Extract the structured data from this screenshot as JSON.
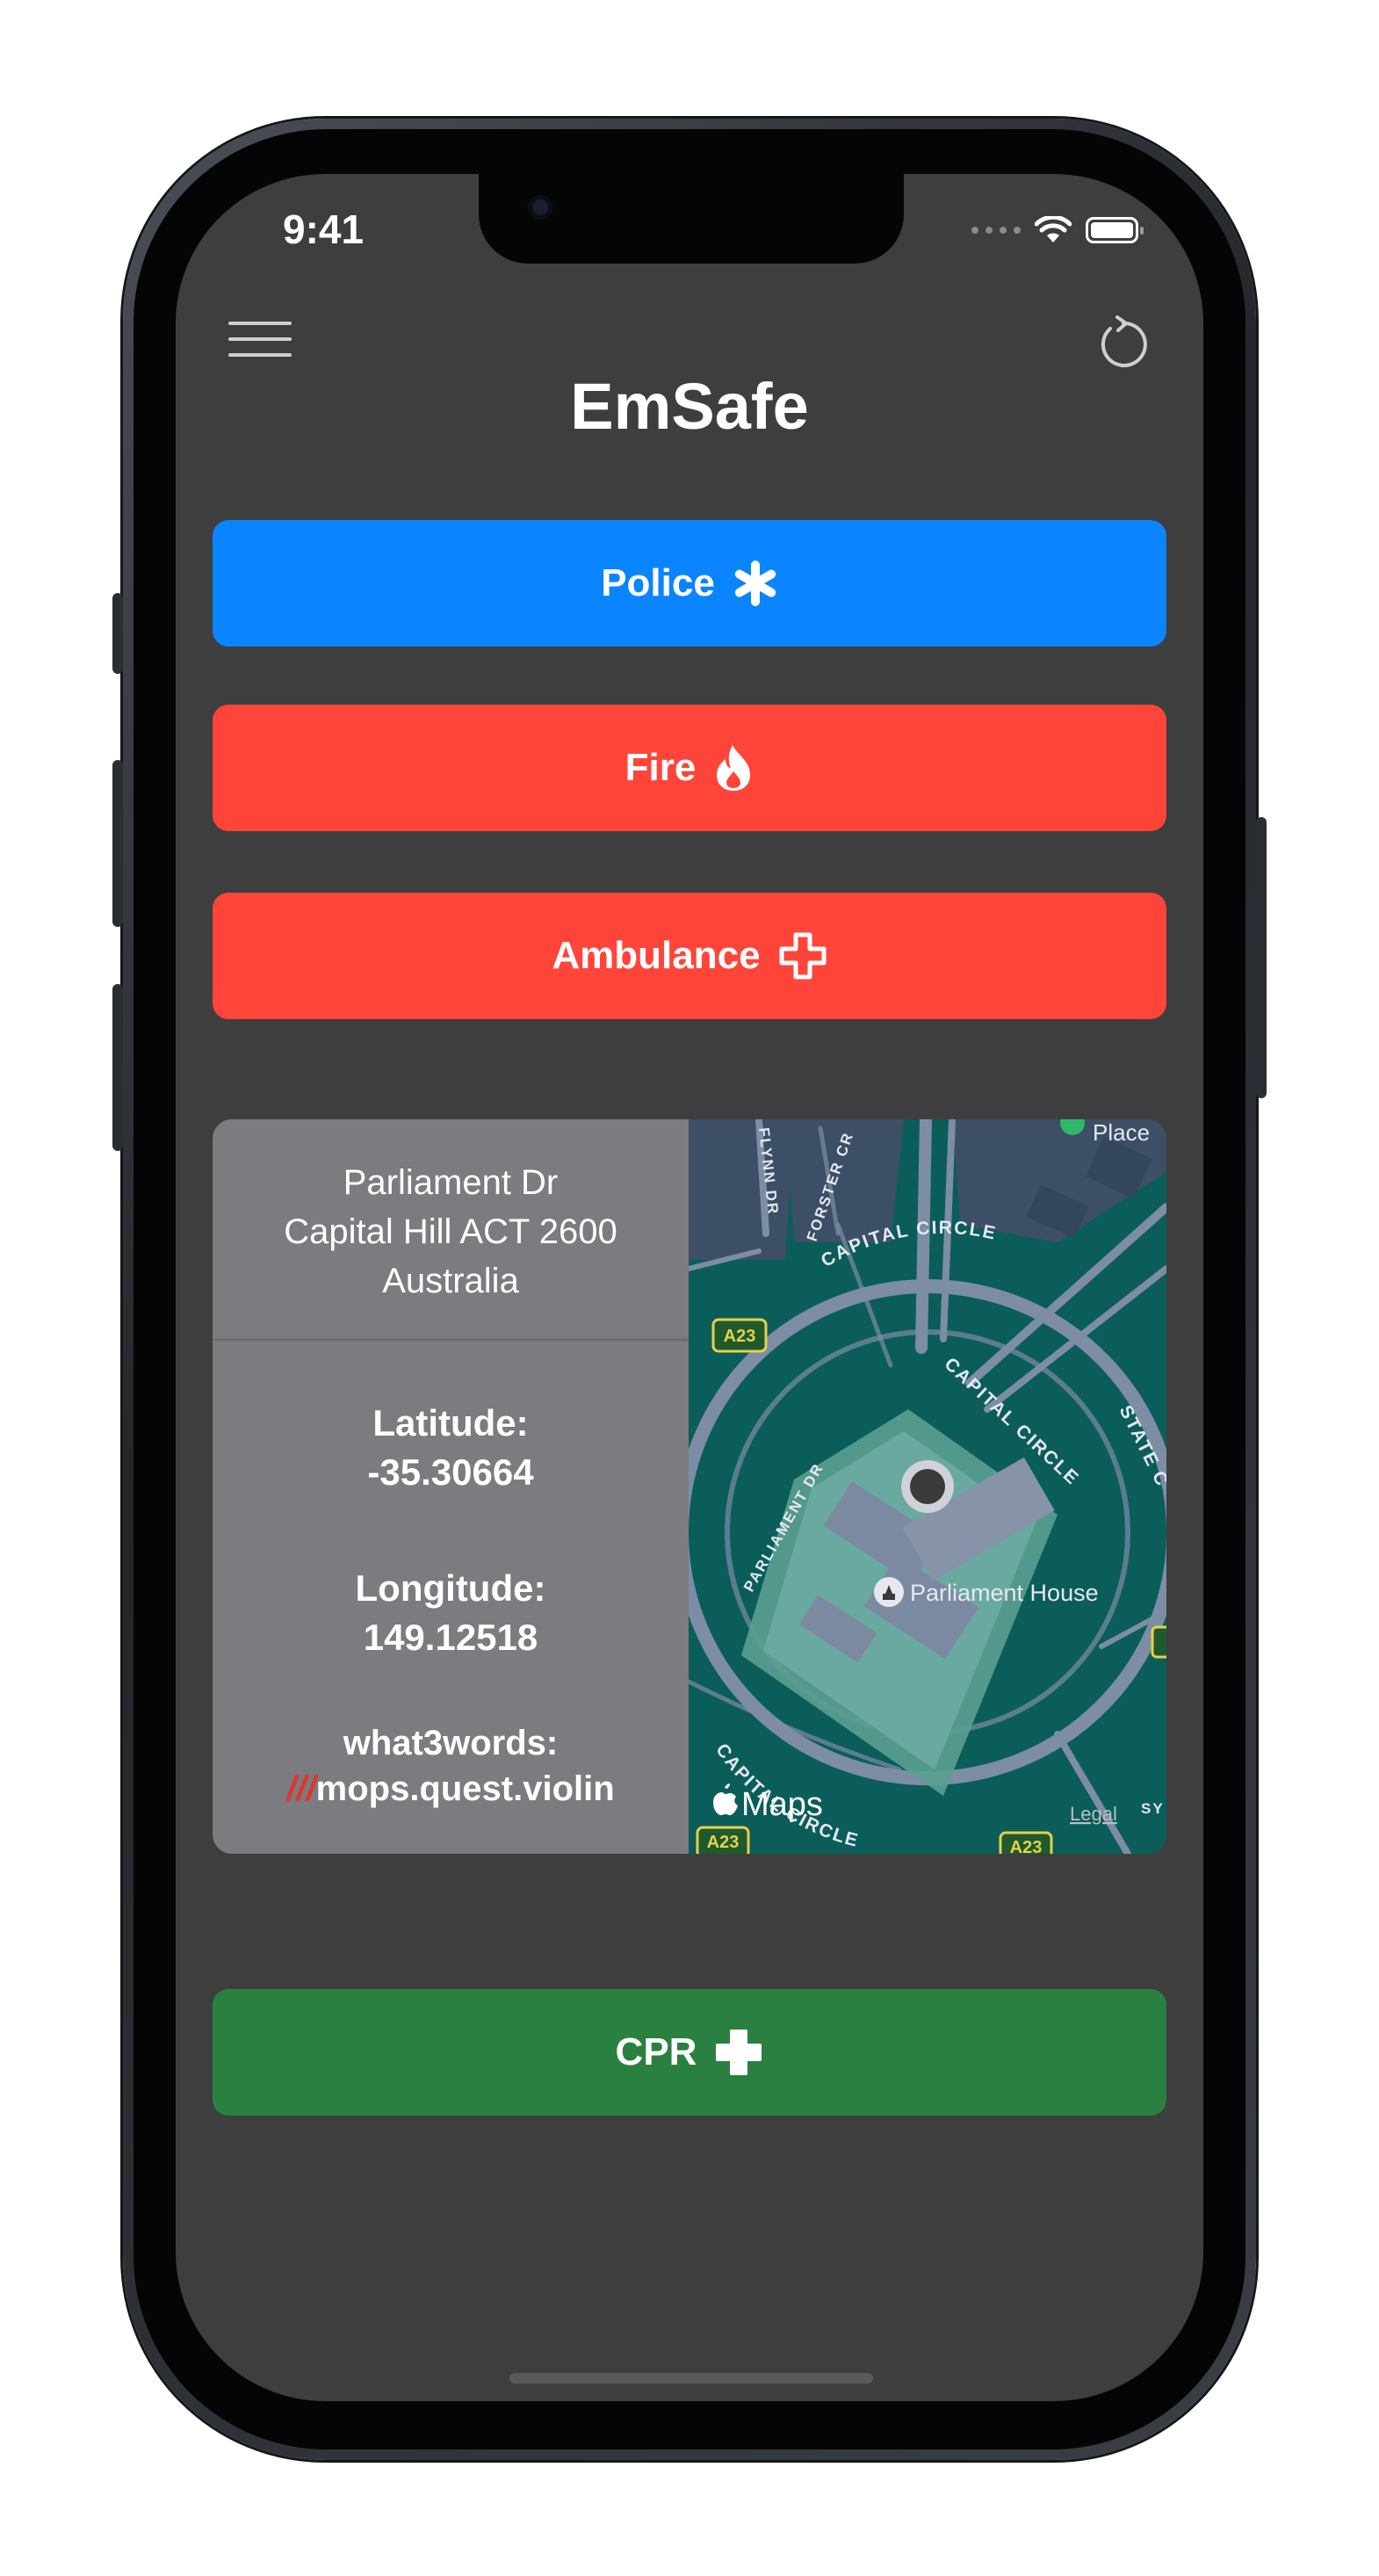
{
  "status_bar": {
    "time": "9:41"
  },
  "header": {
    "title": "EmSafe"
  },
  "buttons": [
    {
      "id": "police",
      "label": "Police",
      "color": "#0a84ff",
      "icon": "asterisk-icon"
    },
    {
      "id": "fire",
      "label": "Fire",
      "color": "#ff453a",
      "icon": "flame-icon"
    },
    {
      "id": "ambulance",
      "label": "Ambulance",
      "color": "#ff453a",
      "icon": "cross-outline-icon"
    },
    {
      "id": "cpr",
      "label": "CPR",
      "color": "#2a8040",
      "icon": "cross-filled-icon"
    }
  ],
  "location": {
    "address_line1": "Parliament Dr",
    "address_line2": "Capital Hill ACT 2600",
    "address_line3": "Australia",
    "latitude_label": "Latitude:",
    "latitude_value": "-35.30664",
    "longitude_label": "Longitude:",
    "longitude_value": "149.12518",
    "w3w_label": "what3words:",
    "w3w_prefix": "///",
    "w3w_value": "mops.quest.violin"
  },
  "map": {
    "streets": [
      "CAPITAL CIRCLE",
      "CAPITAL CIRCLE",
      "CAPITAL CIRCLE",
      "PARLIAMENT DR",
      "FORSTER CR",
      "FLYNN DR",
      "STATE C",
      "SY"
    ],
    "poi": "Parliament House",
    "place": "Place",
    "route_badge": "A23",
    "attribution": "Maps",
    "legal": "Legal"
  }
}
